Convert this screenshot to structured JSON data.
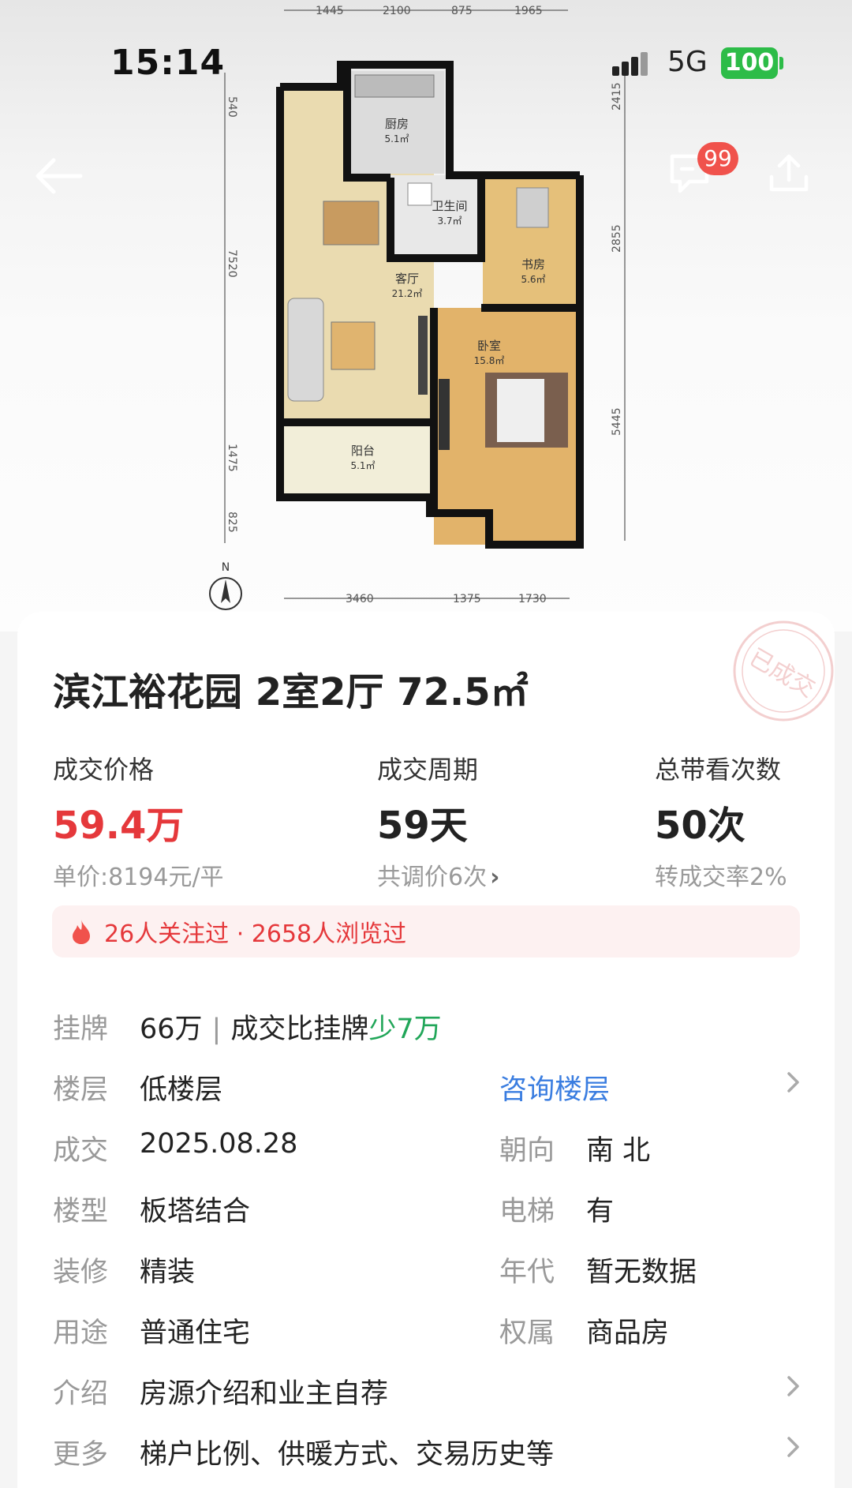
{
  "status_bar": {
    "time": "15:14",
    "network": "5G",
    "battery": "100"
  },
  "nav": {
    "back_icon": "arrow-left-icon",
    "message_icon": "chat-bubble-icon",
    "message_badge": "99",
    "share_icon": "share-upload-icon"
  },
  "floorplan": {
    "dims_top": [
      "1445",
      "2100",
      "875",
      "1965"
    ],
    "dims_bottom": [
      "3460",
      "1375",
      "1730"
    ],
    "dims_left": [
      "540",
      "7520",
      "1475",
      "825"
    ],
    "dims_right": [
      "2415",
      "2855",
      "5445"
    ],
    "compass": "N",
    "rooms": [
      {
        "name": "厨房",
        "area": "5.1㎡"
      },
      {
        "name": "卫生间",
        "area": "3.7㎡"
      },
      {
        "name": "书房",
        "area": "5.6㎡"
      },
      {
        "name": "客厅",
        "area": "21.2㎡"
      },
      {
        "name": "卧室",
        "area": "15.8㎡"
      },
      {
        "name": "阳台",
        "area": "5.1㎡"
      }
    ]
  },
  "listing": {
    "stamp": "已成交",
    "title": "滨江裕花园 2室2厅 72.5㎡",
    "stats": [
      {
        "label": "成交价格",
        "value": "59.4万",
        "sub": "单价:8194元/平"
      },
      {
        "label": "成交周期",
        "value": "59天",
        "sub": "共调价6次"
      },
      {
        "label": "总带看次数",
        "value": "50次",
        "sub": "转成交率2%"
      }
    ],
    "hot": "26人关注过 · 2658人浏览过",
    "listing_row": {
      "label": "挂牌",
      "price": "66万",
      "compare_text": "成交比挂牌",
      "compare_diff": "少7万"
    },
    "floor_row": {
      "label": "楼层",
      "value": "低楼层",
      "link": "咨询楼层"
    },
    "rows": [
      {
        "l1": "成交",
        "v1": "2025.08.28",
        "l2": "朝向",
        "v2": "南 北"
      },
      {
        "l1": "楼型",
        "v1": "板塔结合",
        "l2": "电梯",
        "v2": "有"
      },
      {
        "l1": "装修",
        "v1": "精装",
        "l2": "年代",
        "v2": "暂无数据"
      },
      {
        "l1": "用途",
        "v1": "普通住宅",
        "l2": "权属",
        "v2": "商品房"
      }
    ],
    "intro_row": {
      "label": "介绍",
      "value": "房源介绍和业主自荐"
    },
    "more_row": {
      "label": "更多",
      "value": "梯户比例、供暖方式、交易历史等"
    }
  }
}
